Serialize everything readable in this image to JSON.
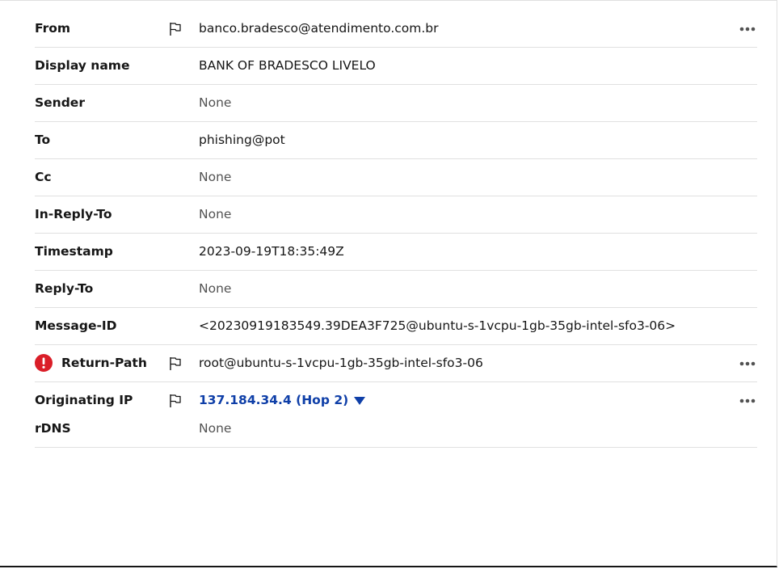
{
  "headers": [
    {
      "label": "From",
      "value": "banco.bradesco@atendimento.com.br",
      "is_none": false,
      "flag": true,
      "more": true,
      "alert": false
    },
    {
      "label": "Display name",
      "value": "BANK OF BRADESCO LIVELO",
      "is_none": false,
      "flag": false,
      "more": false,
      "alert": false
    },
    {
      "label": "Sender",
      "value": "None",
      "is_none": true,
      "flag": false,
      "more": false,
      "alert": false
    },
    {
      "label": "To",
      "value": "phishing@pot",
      "is_none": false,
      "flag": false,
      "more": false,
      "alert": false
    },
    {
      "label": "Cc",
      "value": "None",
      "is_none": true,
      "flag": false,
      "more": false,
      "alert": false
    },
    {
      "label": "In-Reply-To",
      "value": "None",
      "is_none": true,
      "flag": false,
      "more": false,
      "alert": false
    },
    {
      "label": "Timestamp",
      "value": "2023-09-19T18:35:49Z",
      "is_none": false,
      "flag": false,
      "more": false,
      "alert": false
    },
    {
      "label": "Reply-To",
      "value": "None",
      "is_none": true,
      "flag": false,
      "more": false,
      "alert": false
    },
    {
      "label": "Message-ID",
      "value": "<20230919183549.39DEA3F725@ubuntu-s-1vcpu-1gb-35gb-intel-sfo3-06>",
      "is_none": false,
      "flag": false,
      "more": false,
      "alert": false
    },
    {
      "label": "Return-Path",
      "value": "root@ubuntu-s-1vcpu-1gb-35gb-intel-sfo3-06",
      "is_none": false,
      "flag": true,
      "more": true,
      "alert": true
    }
  ],
  "originating": {
    "label": "Originating IP",
    "value": "137.184.34.4 (Hop 2)",
    "rdns_label": "rDNS",
    "rdns_value": "None"
  },
  "colors": {
    "link": "#0f3fa8",
    "alert": "#da1e28",
    "none_text": "#525252",
    "divider": "#e0e0e0"
  },
  "icons": {
    "flag": "flag-icon",
    "more": "overflow-menu-icon",
    "alert": "error-filled-icon",
    "caret": "caret-down-icon"
  }
}
